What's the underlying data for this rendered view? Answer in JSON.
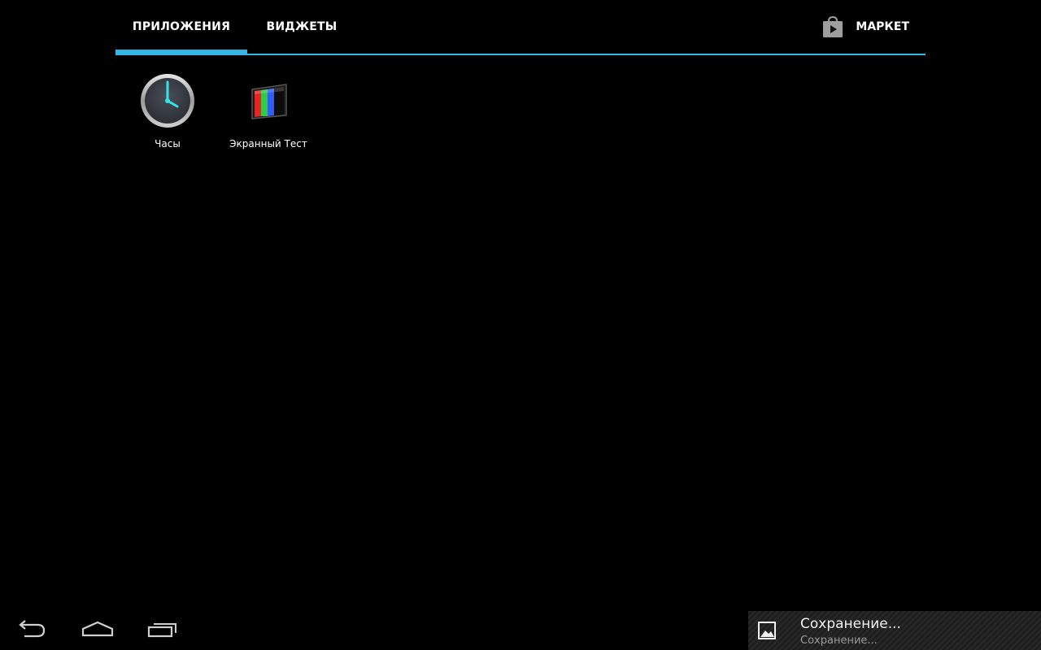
{
  "tabs": {
    "apps_label": "ПРИЛОЖЕНИЯ",
    "widgets_label": "ВИДЖЕТЫ",
    "selected": "apps"
  },
  "market": {
    "label": "МАРКЕТ",
    "icon": "market-bag-icon"
  },
  "apps": [
    {
      "label": "Часы",
      "icon": "clock-icon"
    },
    {
      "label": "Экранный Тест",
      "icon": "screen-test-icon"
    }
  ],
  "navigation": {
    "back_icon": "back-icon",
    "home_icon": "home-icon",
    "recent_icon": "recent-apps-icon"
  },
  "notification": {
    "icon": "image-icon",
    "title": "Сохранение...",
    "text": "Сохранение..."
  },
  "colors": {
    "accent": "#33b5e5",
    "background": "#000000",
    "clock_hands": "#33e5e5"
  }
}
